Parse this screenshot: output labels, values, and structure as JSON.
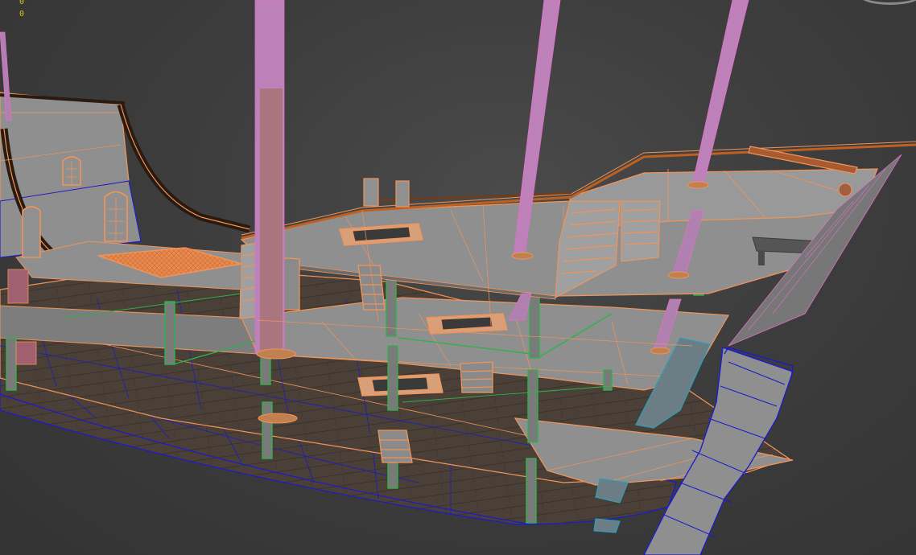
{
  "viewport": {
    "background": "#3b3b3b",
    "stats": {
      "line1": "0",
      "line2": "0",
      "color": "#d4c21a"
    },
    "viewcube_icon": "viewcube-ring-icon"
  },
  "colors": {
    "selected_wire": "#f0945a",
    "deck_fill": "#8f8f8f",
    "deck_dark": "#6c6c6c",
    "support_wire": "#2fb24a",
    "hull_wire": "#1a1ad0",
    "mast_wire": "#e070c8",
    "hull_planks": "#4a4038",
    "teal_wire": "#2aa0b8"
  }
}
